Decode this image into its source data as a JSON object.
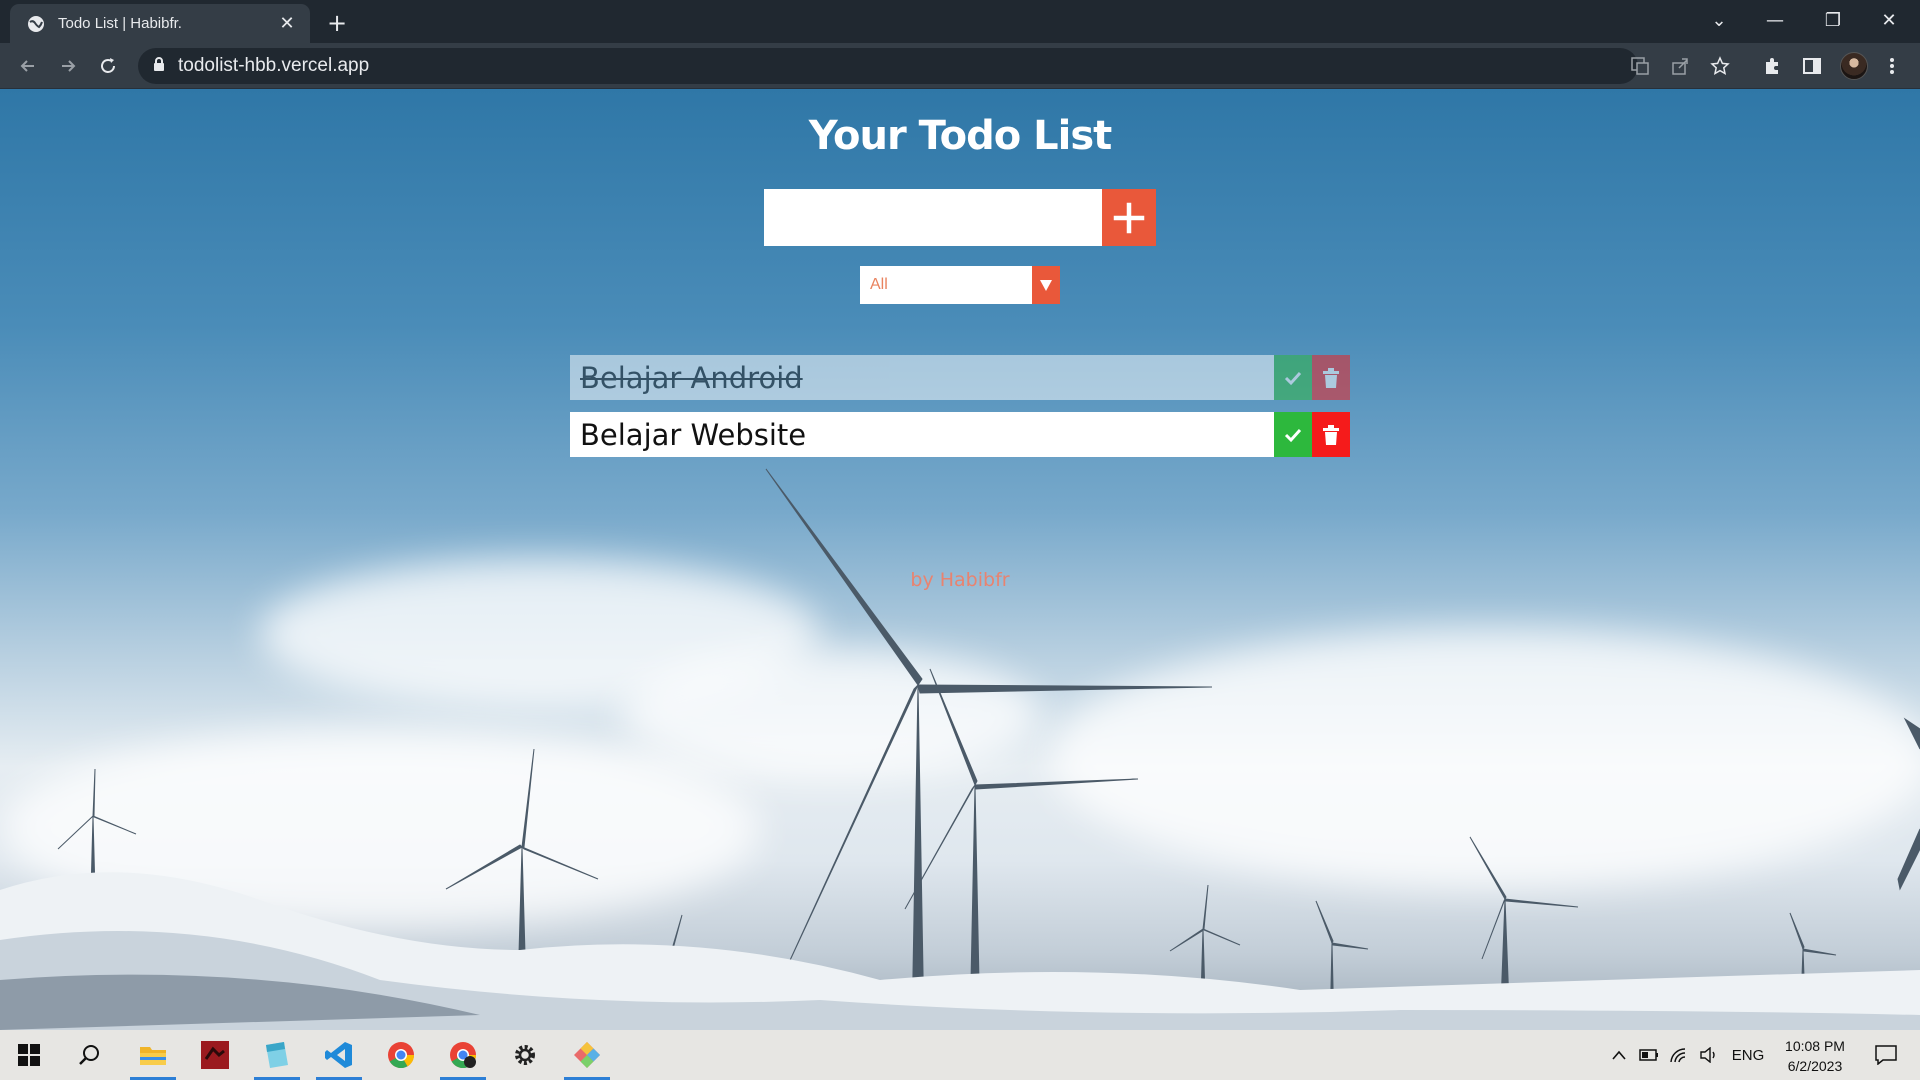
{
  "browser": {
    "tab_title": "Todo List | Habibfr.",
    "url": "todolist-hbb.vercel.app"
  },
  "app": {
    "title": "Your Todo List",
    "input_placeholder": "",
    "add_icon": "plus-icon",
    "filter_selected": "All",
    "todos": [
      {
        "text": "Belajar Android",
        "completed": true
      },
      {
        "text": "Belajar Website",
        "completed": false
      }
    ],
    "credit": "by Habibfr"
  },
  "taskbar": {
    "apps": [
      "windows-start",
      "search",
      "file-explorer",
      "app-red",
      "notepad",
      "vscode",
      "chrome",
      "chrome-profile",
      "settings",
      "git-app"
    ],
    "language": "ENG",
    "time": "10:08 PM",
    "date": "6/2/2023"
  },
  "colors": {
    "accent": "#e9583a",
    "check": "#2db83d",
    "trash": "#f51b1b",
    "credit": "#e9836f"
  }
}
